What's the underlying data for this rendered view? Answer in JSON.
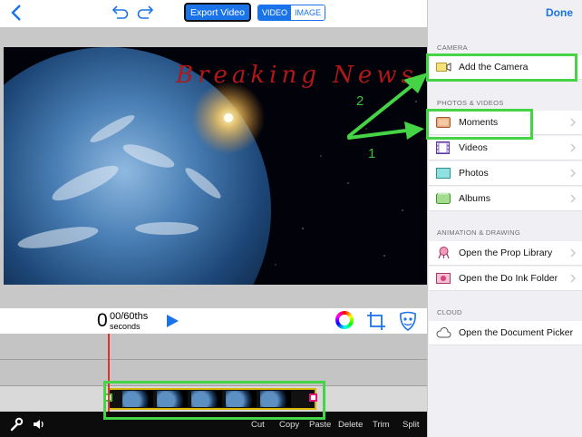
{
  "toolbar": {
    "back_icon": "chevron-left-icon",
    "undo_icon": "undo-icon",
    "redo_icon": "redo-icon",
    "export_label": "Export Video",
    "mode_video": "VIDEO",
    "mode_image": "IMAGE",
    "accent": "#1a73e8"
  },
  "stage": {
    "headline": "Breaking News ..."
  },
  "transport": {
    "time_value": "0",
    "time_fraction": "00/60ths",
    "time_unit": "seconds",
    "play_icon": "play-icon",
    "color_icon": "color-wheel-icon",
    "crop_icon": "crop-icon",
    "mask_icon": "mask-icon"
  },
  "bottom_bar": {
    "tool_icon": "wrench-icon",
    "sound_icon": "speaker-icon",
    "actions": [
      "Cut",
      "Copy",
      "Paste",
      "Delete",
      "Trim",
      "Split"
    ]
  },
  "sidebar": {
    "done_label": "Done",
    "sections": [
      {
        "header": "CAMERA",
        "items": [
          {
            "label": "Add the Camera",
            "icon": "camera-icon"
          }
        ]
      },
      {
        "header": "PHOTOS & VIDEOS",
        "items": [
          {
            "label": "Moments",
            "icon": "moments-icon"
          },
          {
            "label": "Videos",
            "icon": "film-icon"
          },
          {
            "label": "Photos",
            "icon": "photos-icon"
          },
          {
            "label": "Albums",
            "icon": "albums-icon"
          }
        ]
      },
      {
        "header": "ANIMATION & DRAWING",
        "items": [
          {
            "label": "Open the Prop Library",
            "icon": "prop-library-icon"
          },
          {
            "label": "Open the Do Ink Folder",
            "icon": "doink-folder-icon"
          }
        ]
      },
      {
        "header": "CLOUD",
        "items": [
          {
            "label": "Open the Document Picker",
            "icon": "cloud-icon"
          }
        ]
      }
    ]
  },
  "annotations": {
    "label_1": "1",
    "label_2": "2",
    "color": "#45d445"
  }
}
